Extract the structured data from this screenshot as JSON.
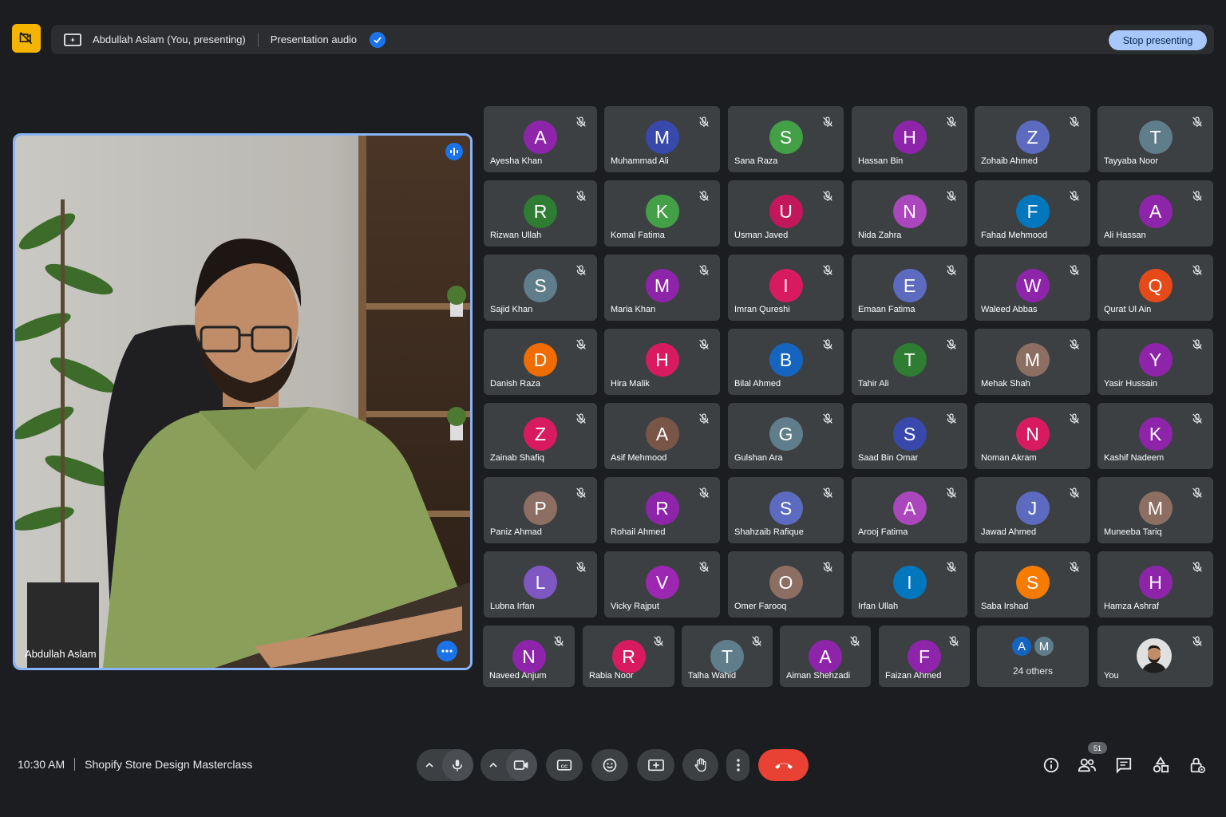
{
  "topbar": {
    "presenter_label": "Abdullah Aslam (You, presenting)",
    "audio_label": "Presentation audio",
    "stop_label": "Stop presenting"
  },
  "presenter": {
    "name": "Abdullah Aslam"
  },
  "participants": [
    {
      "name": "Ayesha Khan",
      "initial": "A",
      "color": "#8e24aa"
    },
    {
      "name": "Muhammad Ali",
      "initial": "M",
      "color": "#3949ab"
    },
    {
      "name": "Sana Raza",
      "initial": "S",
      "color": "#43a047"
    },
    {
      "name": "Hassan Bin",
      "initial": "H",
      "color": "#8e24aa"
    },
    {
      "name": "Zohaib Ahmed",
      "initial": "Z",
      "color": "#5c6bc0"
    },
    {
      "name": "Tayyaba Noor",
      "initial": "T",
      "color": "#607d8b"
    },
    {
      "name": "Rizwan Ullah",
      "initial": "R",
      "color": "#2e7d32"
    },
    {
      "name": "Komal Fatima",
      "initial": "K",
      "color": "#43a047"
    },
    {
      "name": "Usman Javed",
      "initial": "U",
      "color": "#c2185b"
    },
    {
      "name": "Nida Zahra",
      "initial": "N",
      "color": "#ab47bc"
    },
    {
      "name": "Fahad Mehmood",
      "initial": "F",
      "color": "#0277bd"
    },
    {
      "name": "Ali Hassan",
      "initial": "A",
      "color": "#8e24aa"
    },
    {
      "name": "Sajid Khan",
      "initial": "S",
      "color": "#607d8b"
    },
    {
      "name": "Maria Khan",
      "initial": "M",
      "color": "#8e24aa"
    },
    {
      "name": "Imran Qureshi",
      "initial": "I",
      "color": "#d81b60"
    },
    {
      "name": "Emaan Fatima",
      "initial": "E",
      "color": "#5c6bc0"
    },
    {
      "name": "Waleed Abbas",
      "initial": "W",
      "color": "#8e24aa"
    },
    {
      "name": "Qurat Ul Ain",
      "initial": "Q",
      "color": "#e64a19"
    },
    {
      "name": "Danish Raza",
      "initial": "D",
      "color": "#ef6c00"
    },
    {
      "name": "Hira Malik",
      "initial": "H",
      "color": "#d81b60"
    },
    {
      "name": "Bilal Ahmed",
      "initial": "B",
      "color": "#1565c0"
    },
    {
      "name": "Tahir Ali",
      "initial": "T",
      "color": "#2e7d32"
    },
    {
      "name": "Mehak Shah",
      "initial": "M",
      "color": "#8d6e63"
    },
    {
      "name": "Yasir Hussain",
      "initial": "Y",
      "color": "#8e24aa"
    },
    {
      "name": "Zainab Shafiq",
      "initial": "Z",
      "color": "#d81b60"
    },
    {
      "name": "Asif Mehmood",
      "initial": "A",
      "color": "#795548"
    },
    {
      "name": "Gulshan Ara",
      "initial": "G",
      "color": "#607d8b"
    },
    {
      "name": "Saad Bin Omar",
      "initial": "S",
      "color": "#3949ab"
    },
    {
      "name": "Noman Akram",
      "initial": "N",
      "color": "#d81b60"
    },
    {
      "name": "Kashif Nadeem",
      "initial": "K",
      "color": "#8e24aa"
    },
    {
      "name": "Paniz Ahmad",
      "initial": "P",
      "color": "#8d6e63"
    },
    {
      "name": "Rohail Ahmed",
      "initial": "R",
      "color": "#8e24aa"
    },
    {
      "name": "Shahzaib Rafique",
      "initial": "S",
      "color": "#5c6bc0"
    },
    {
      "name": "Arooj Fatima",
      "initial": "A",
      "color": "#ab47bc"
    },
    {
      "name": "Jawad Ahmed",
      "initial": "J",
      "color": "#5c6bc0"
    },
    {
      "name": "Muneeba Tariq",
      "initial": "M",
      "color": "#8d6e63"
    },
    {
      "name": "Lubna Irfan",
      "initial": "L",
      "color": "#7e57c2"
    },
    {
      "name": "Vicky Rajput",
      "initial": "V",
      "color": "#9c27b0"
    },
    {
      "name": "Omer Farooq",
      "initial": "O",
      "color": "#8d6e63"
    },
    {
      "name": "Irfan Ullah",
      "initial": "I",
      "color": "#0277bd"
    },
    {
      "name": "Saba Irshad",
      "initial": "S",
      "color": "#f57c00"
    },
    {
      "name": "Hamza Ashraf",
      "initial": "H",
      "color": "#8e24aa"
    }
  ],
  "last_row": [
    {
      "name": "Naveed Anjum",
      "initial": "N",
      "color": "#8e24aa"
    },
    {
      "name": "Rabia Noor",
      "initial": "R",
      "color": "#d81b60"
    },
    {
      "name": "Talha Wahid",
      "initial": "T",
      "color": "#607d8b"
    },
    {
      "name": "Aiman Shehzadi",
      "initial": "A",
      "color": "#8e24aa"
    },
    {
      "name": "Faizan Ahmed",
      "initial": "F",
      "color": "#8e24aa"
    }
  ],
  "others": {
    "label": "24 others",
    "avatars": [
      {
        "initial": "A",
        "color": "#1565c0"
      },
      {
        "initial": "M",
        "color": "#607d8b"
      }
    ]
  },
  "self_tile": {
    "label": "You"
  },
  "meeting": {
    "time": "10:30 AM",
    "title": "Shopify Store Design Masterclass"
  },
  "people_count": "51",
  "icons": {
    "top_indicator": "camera-off-icon",
    "controls": [
      "chevron-up-icon",
      "microphone-icon",
      "chevron-up-icon",
      "camera-icon",
      "captions-icon",
      "emoji-icon",
      "present-screen-icon",
      "raise-hand-icon",
      "more-vert-icon",
      "end-call-icon"
    ],
    "right": [
      "info-icon",
      "people-icon",
      "chat-icon",
      "activities-icon",
      "host-controls-icon"
    ]
  },
  "colors": {
    "accent": "#8ab4f8",
    "stop_button": "#a8c7fa",
    "end_call": "#e94235",
    "top_indicator": "#f4b400",
    "tile_bg": "#3c4043",
    "page_bg": "#1b1d20"
  }
}
